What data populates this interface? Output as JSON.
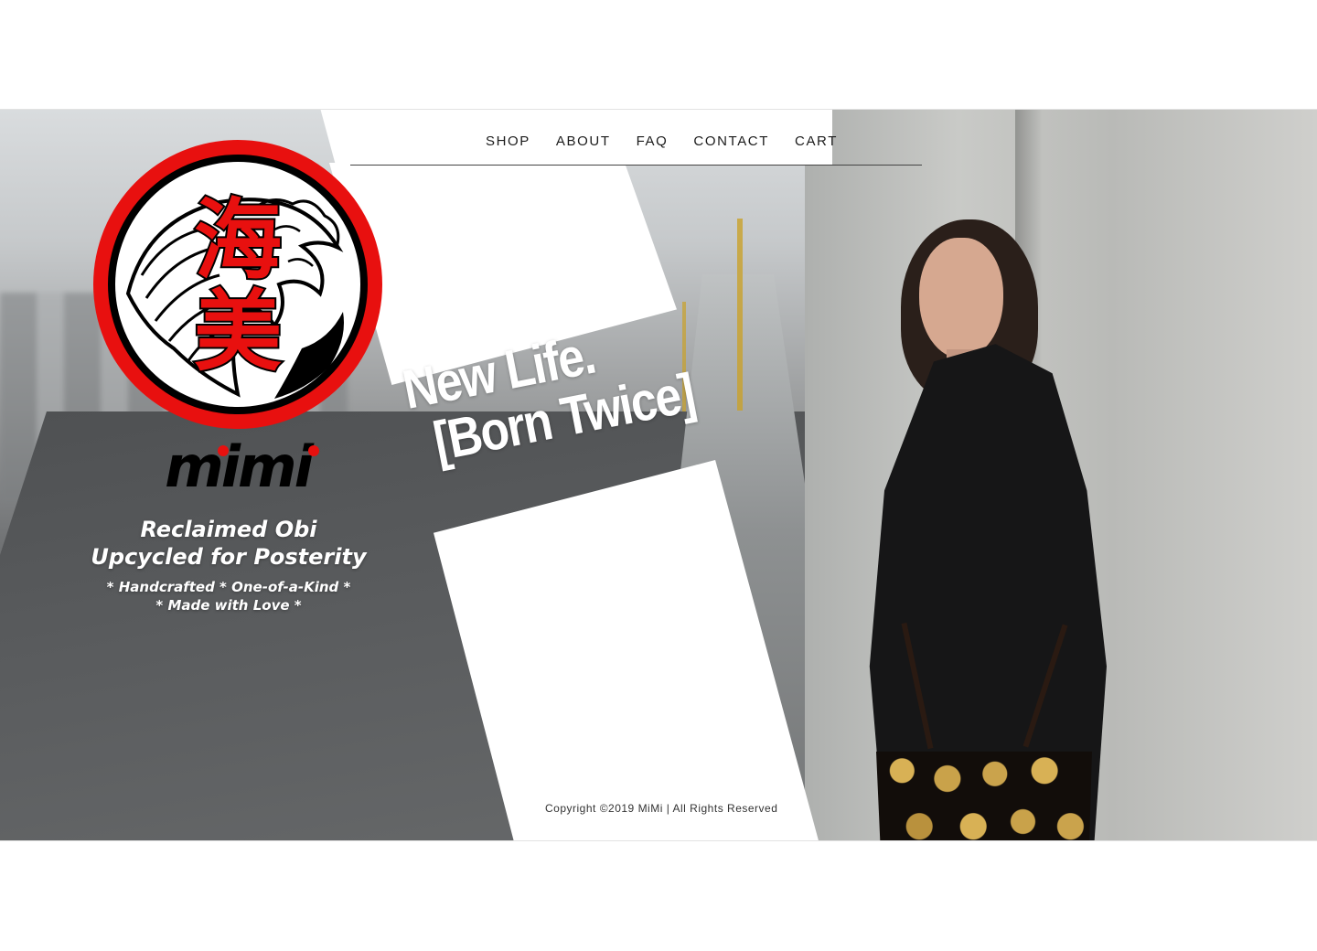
{
  "nav": {
    "items": [
      {
        "label": "SHOP"
      },
      {
        "label": "ABOUT"
      },
      {
        "label": "FAQ"
      },
      {
        "label": "CONTACT"
      },
      {
        "label": "CART"
      }
    ]
  },
  "logo": {
    "kanji_1": "海",
    "kanji_2": "美",
    "wordmark": "mimi"
  },
  "tagline": {
    "line1": "Reclaimed Obi",
    "line2": "Upcycled for Posterity",
    "line3": "* Handcrafted * One-of-a-Kind *",
    "line4": "* Made with Love *"
  },
  "headline": {
    "line1": "New Life.",
    "line2": "[Born Twice]"
  },
  "footer": {
    "copyright": "Copyright ©2019 MiMi | All Rights Reserved"
  },
  "colors": {
    "brand_red": "#e8100f",
    "black": "#000000",
    "white": "#ffffff"
  },
  "icons": [
    "wave-emblem-icon"
  ]
}
